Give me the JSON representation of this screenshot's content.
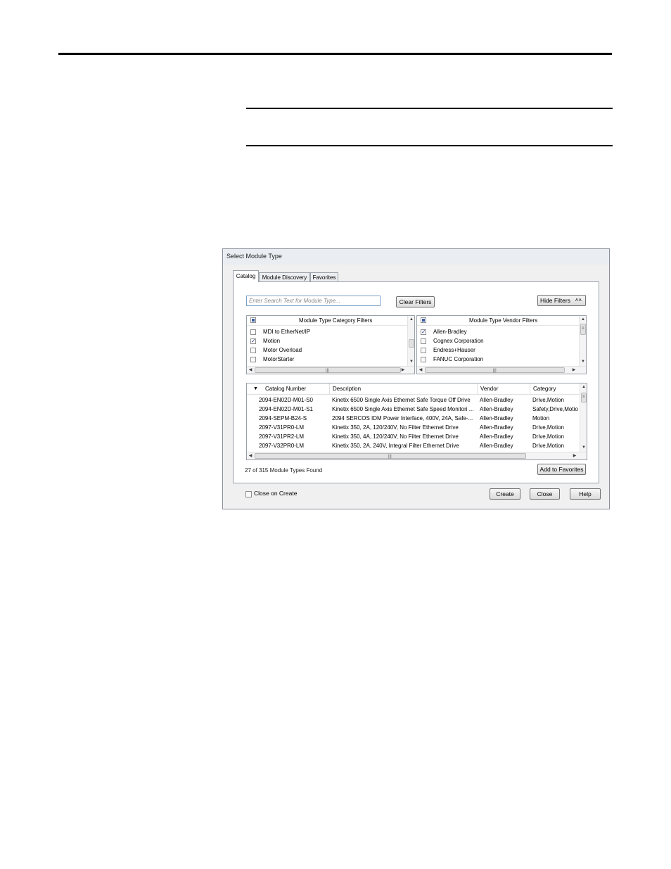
{
  "dialog": {
    "title": "Select Module Type",
    "tabs": [
      "Catalog",
      "Module Discovery",
      "Favorites"
    ],
    "search_placeholder": "Enter Search Text for Module Type...",
    "clear_filters": "Clear Filters",
    "hide_filters": "Hide Filters",
    "hide_filters_icon": "double-chevron-up-icon",
    "category_filters": {
      "header": "Module Type Category Filters",
      "items": [
        {
          "label": "MDI to EtherNet/IP",
          "checked": false
        },
        {
          "label": "Motion",
          "checked": true
        },
        {
          "label": "Motor Overload",
          "checked": false
        },
        {
          "label": "MotorStarter",
          "checked": false
        }
      ]
    },
    "vendor_filters": {
      "header": "Module Type Vendor Filters",
      "items": [
        {
          "label": "Allen-Bradley",
          "checked": true
        },
        {
          "label": "Cognex Corporation",
          "checked": false
        },
        {
          "label": "Endress+Hauser",
          "checked": false
        },
        {
          "label": "FANUC Corporation",
          "checked": false
        }
      ]
    },
    "results": {
      "columns": [
        "Catalog Number",
        "Description",
        "Vendor",
        "Category"
      ],
      "rows": [
        {
          "catalog": "2094-EN02D-M01-S0",
          "description": "Kinetix 6500 Single Axis Ethernet Safe Torque Off Drive",
          "vendor": "Allen-Bradley",
          "category": "Drive,Motion"
        },
        {
          "catalog": "2094-EN02D-M01-S1",
          "description": "Kinetix 6500 Single Axis Ethernet Safe Speed Monitori ...",
          "vendor": "Allen-Bradley",
          "category": "Safety,Drive,Motio"
        },
        {
          "catalog": "2094-SEPM-B24-S",
          "description": "2094 SERCOS IDM Power Interface, 400V, 24A, Safe-...",
          "vendor": "Allen-Bradley",
          "category": "Motion"
        },
        {
          "catalog": "2097-V31PR0-LM",
          "description": "Kinetix 350, 2A, 120/240V, No Filter Ethernet Drive",
          "vendor": "Allen-Bradley",
          "category": "Drive,Motion"
        },
        {
          "catalog": "2097-V31PR2-LM",
          "description": "Kinetix 350, 4A, 120/240V, No Filter Ethernet Drive",
          "vendor": "Allen-Bradley",
          "category": "Drive,Motion"
        },
        {
          "catalog": "2097-V32PR0-LM",
          "description": "Kinetix 350, 2A, 240V, Integral Filter Ethernet Drive",
          "vendor": "Allen-Bradley",
          "category": "Drive,Motion"
        }
      ]
    },
    "found_text": "27 of 315 Module Types Found",
    "add_to_favorites": "Add to Favorites",
    "close_on_create": "Close on Create",
    "create": "Create",
    "close": "Close",
    "help": "Help"
  }
}
